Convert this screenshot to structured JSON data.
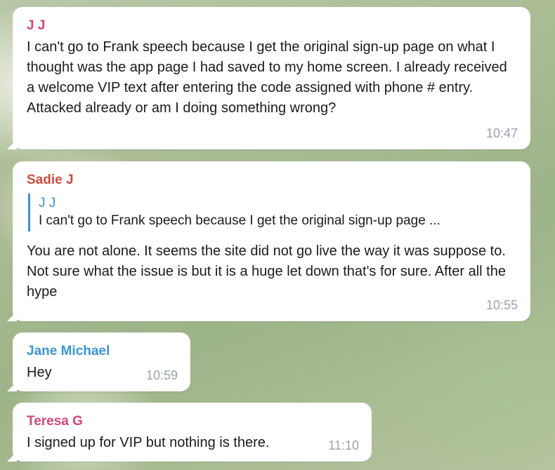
{
  "messages": [
    {
      "sender": "J J",
      "sender_color": "#d2477a",
      "text": "I can't go to Frank speech because I get the original sign-up page on what I thought was the app page I had saved to my home screen. I already received a welcome VIP text after entering the code assigned with phone # entry. Attacked already or am I doing something wrong?",
      "time": "10:47"
    },
    {
      "sender": "Sadie J",
      "sender_color": "#d14b3e",
      "reply": {
        "name": "J J",
        "text": "I can't go to Frank speech because I get the original sign-up page ..."
      },
      "text": "You are not alone. It seems the site did not go live the way it was suppose to. Not sure what the issue is but it is a huge let down that's for sure. After all the hype",
      "time": "10:55"
    },
    {
      "sender": "Jane Michael",
      "sender_color": "#3a97d4",
      "text": "Hey",
      "time": "10:59"
    },
    {
      "sender": "Teresa G",
      "sender_color": "#d2477a",
      "text": "I signed up for VIP but nothing is there.",
      "time": "11:10"
    }
  ]
}
